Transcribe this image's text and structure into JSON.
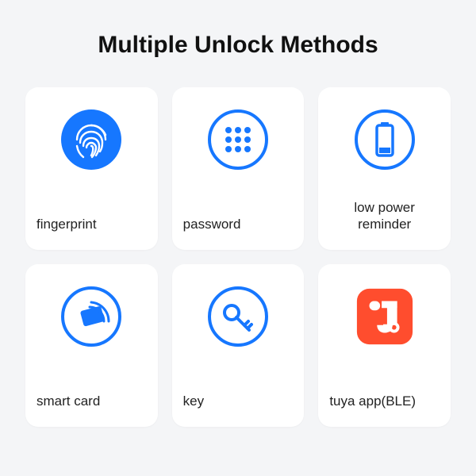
{
  "title": "Multiple Unlock Methods",
  "colors": {
    "accent": "#1677ff",
    "tuya_red": "#ff4d2e"
  },
  "cards": [
    {
      "label": "fingerprint",
      "icon": "fingerprint-icon"
    },
    {
      "label": "password",
      "icon": "keypad-icon"
    },
    {
      "label": "low power reminder",
      "icon": "battery-low-icon"
    },
    {
      "label": "smart card",
      "icon": "smart-card-icon"
    },
    {
      "label": "key",
      "icon": "key-icon"
    },
    {
      "label": "tuya app(BLE)",
      "icon": "tuya-icon"
    }
  ]
}
